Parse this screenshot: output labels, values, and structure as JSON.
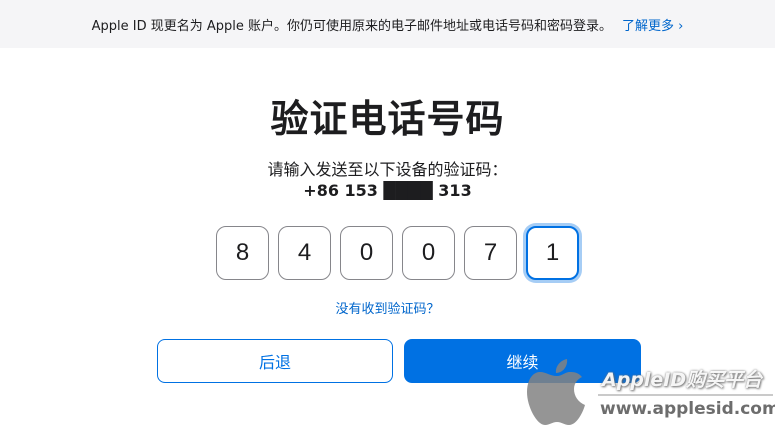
{
  "banner": {
    "text": "Apple ID 现更名为 Apple 账户。你仍可使用原来的电子邮件地址或电话号码和密码登录。",
    "link_label": "了解更多 ›"
  },
  "title": "验证电话号码",
  "subtitle": "请输入发送至以下设备的验证码：",
  "phone": "+86 153 ████ 313",
  "code": {
    "digits": [
      "8",
      "4",
      "0",
      "0",
      "7",
      "1"
    ]
  },
  "resend_link": "没有收到验证码？",
  "buttons": {
    "back": "后退",
    "continue": "继续"
  },
  "watermark": {
    "brand": "AppleID购买平台",
    "url": "www.applesid.com"
  },
  "colors": {
    "accent": "#0071e3",
    "link": "#0066cc",
    "banner_bg": "#f5f5f7"
  }
}
